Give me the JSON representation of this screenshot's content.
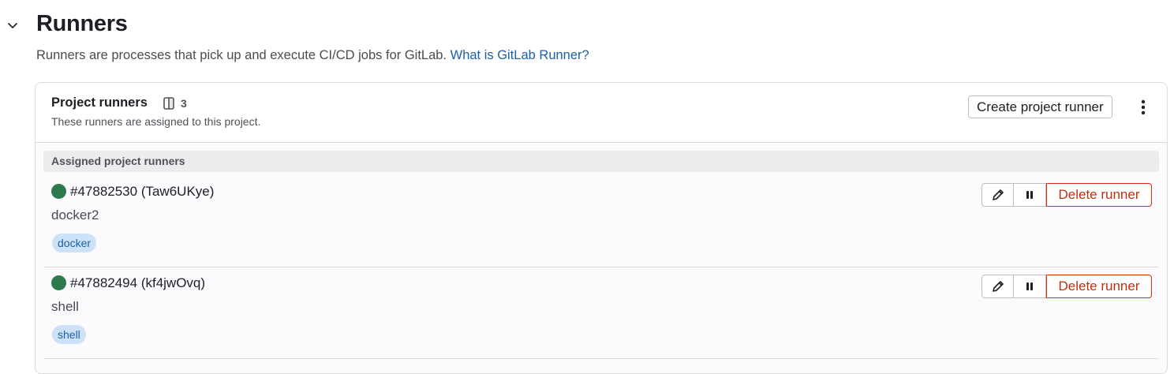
{
  "section": {
    "title": "Runners",
    "description": "Runners are processes that pick up and execute CI/CD jobs for GitLab.",
    "help_link": "What is GitLab Runner?",
    "toggle_icon": "chevron-down-icon"
  },
  "card": {
    "title": "Project runners",
    "count_icon": "runner-icon",
    "count": "3",
    "subtitle": "These runners are assigned to this project.",
    "create_button": "Create project runner",
    "more_icon": "kebab-vertical-icon"
  },
  "group": {
    "label": "Assigned project runners"
  },
  "runners": [
    {
      "id_label": "#47882530 (Taw6UKye)",
      "description": "docker2",
      "tag": "docker",
      "status_color": "#2d7a4d",
      "delete_label": "Delete runner"
    },
    {
      "id_label": "#47882494 (kf4jwOvq)",
      "description": "shell",
      "tag": "shell",
      "status_color": "#2d7a4d",
      "delete_label": "Delete runner"
    }
  ],
  "colors": {
    "link": "#1f5fa3",
    "danger": "#dd2b0e",
    "status_online": "#2d7a4d",
    "tag_bg": "#cbe2f9"
  }
}
